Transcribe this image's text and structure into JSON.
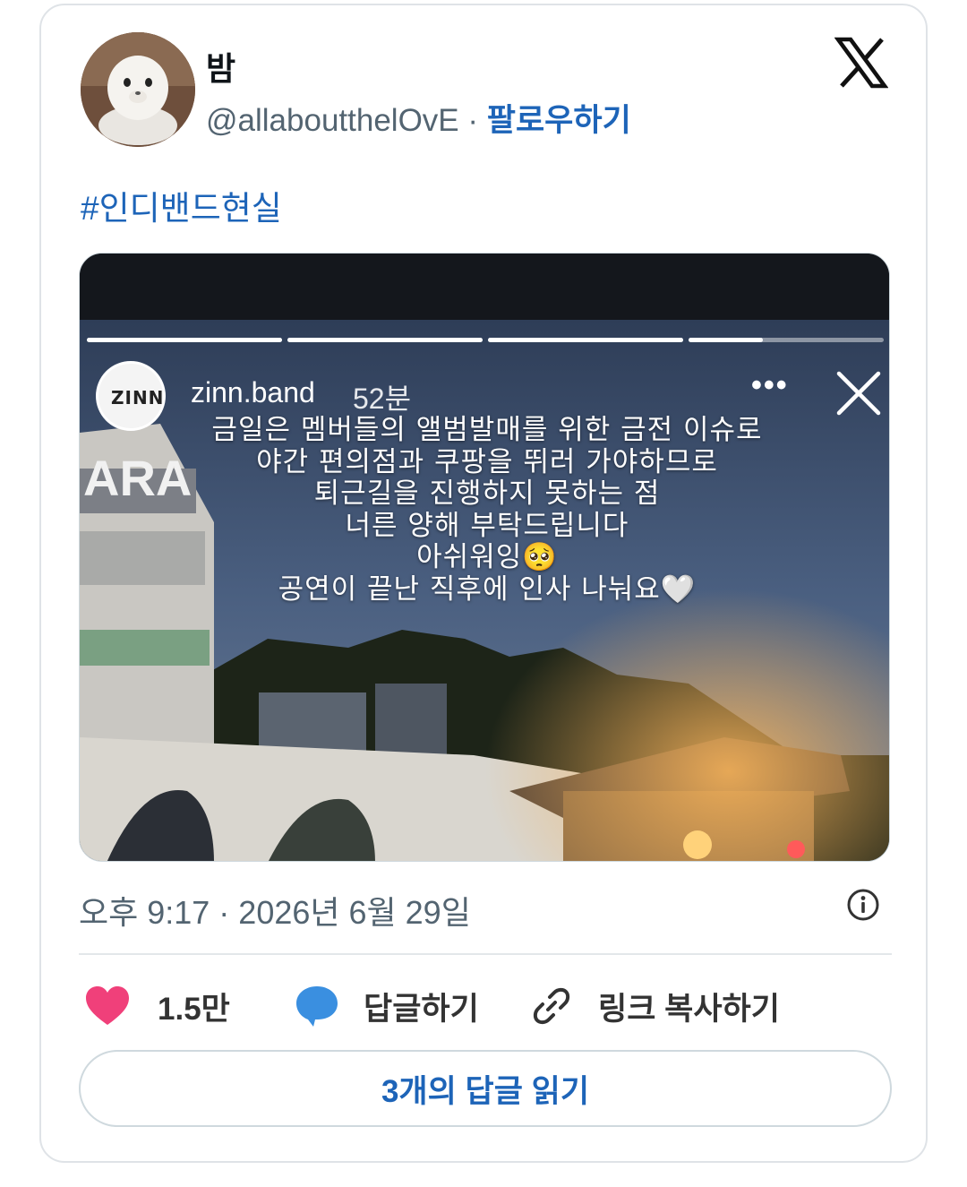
{
  "tweet": {
    "author": {
      "display_name": "밤",
      "handle": "@allaboutthelOvE",
      "separator": "·",
      "follow_label": "팔로우하기"
    },
    "text": "#인디밴드현실",
    "story": {
      "username": "zinn.band",
      "time_ago": "52분",
      "avatar_text": "ZINN",
      "more_label": "•••",
      "caption_lines": [
        "금일은 멤버들의 앨범발매를 위한 금전 이슈로",
        "야간 편의점과 쿠팡을 뛰러 가야하므로",
        "퇴근길을 진행하지 못하는 점",
        "너른 양해 부탁드립니다",
        "아쉬워잉🥺",
        "공연이 끝난 직후에 인사 나눠요🤍"
      ],
      "progress_fill": [
        1,
        1,
        1,
        0.38
      ]
    },
    "timestamp": "오후 9:17 · 2026년 6월 29일",
    "actions": {
      "likes": "1.5만",
      "reply": "답글하기",
      "copy_link": "링크 복사하기"
    },
    "read_replies": "3개의 답글 읽기"
  },
  "icons": {
    "brand": "x-logo-icon",
    "info": "info-icon",
    "like": "heart-icon",
    "reply": "speech-bubble-icon",
    "link": "link-icon",
    "close": "close-icon"
  },
  "colors": {
    "link_blue": "#1d64b8",
    "heart": "#f0407a",
    "bubble": "#3a8fe0",
    "secondary_text": "#536471",
    "border": "#cfd9de"
  }
}
